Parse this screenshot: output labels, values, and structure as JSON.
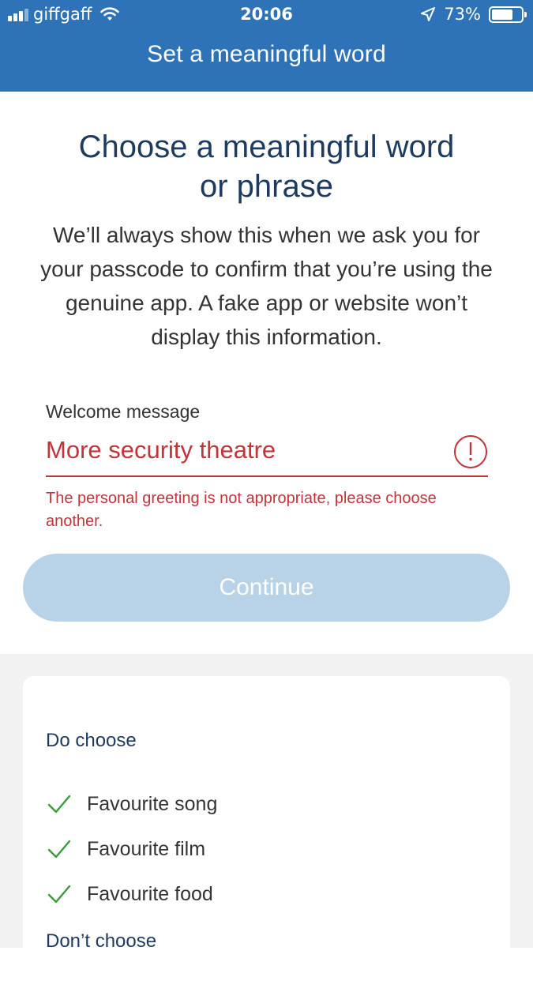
{
  "status_bar": {
    "carrier": "giffgaff",
    "time": "20:06",
    "battery": "73%",
    "battery_level": 0.73
  },
  "header": {
    "title": "Set a meaningful word"
  },
  "main": {
    "heading_line1": "Choose a meaningful word",
    "heading_line2": "or phrase",
    "description": "We’ll always show this when we ask you for your passcode to confirm that you’re using the genuine app. A fake app or website won’t display this information.",
    "field_label": "Welcome message",
    "field_value": "More security theatre",
    "error_message": "The personal greeting is not appropriate, please choose another.",
    "continue_label": "Continue"
  },
  "tips": {
    "do_heading": "Do choose",
    "do_items": [
      "Favourite song",
      "Favourite film",
      "Favourite food"
    ],
    "dont_heading": "Don’t choose"
  },
  "colors": {
    "header_blue": "#2e73b8",
    "error_red": "#c0343a",
    "heading_navy": "#1d3b5e",
    "button_disabled": "#b8d3e8",
    "check_green": "#3c9a3c"
  },
  "icons": {
    "signal": "cellular-signal-icon",
    "wifi": "wifi-icon",
    "location": "location-arrow-icon",
    "battery": "battery-icon",
    "error": "exclamation-circle-icon",
    "check": "checkmark-icon"
  }
}
